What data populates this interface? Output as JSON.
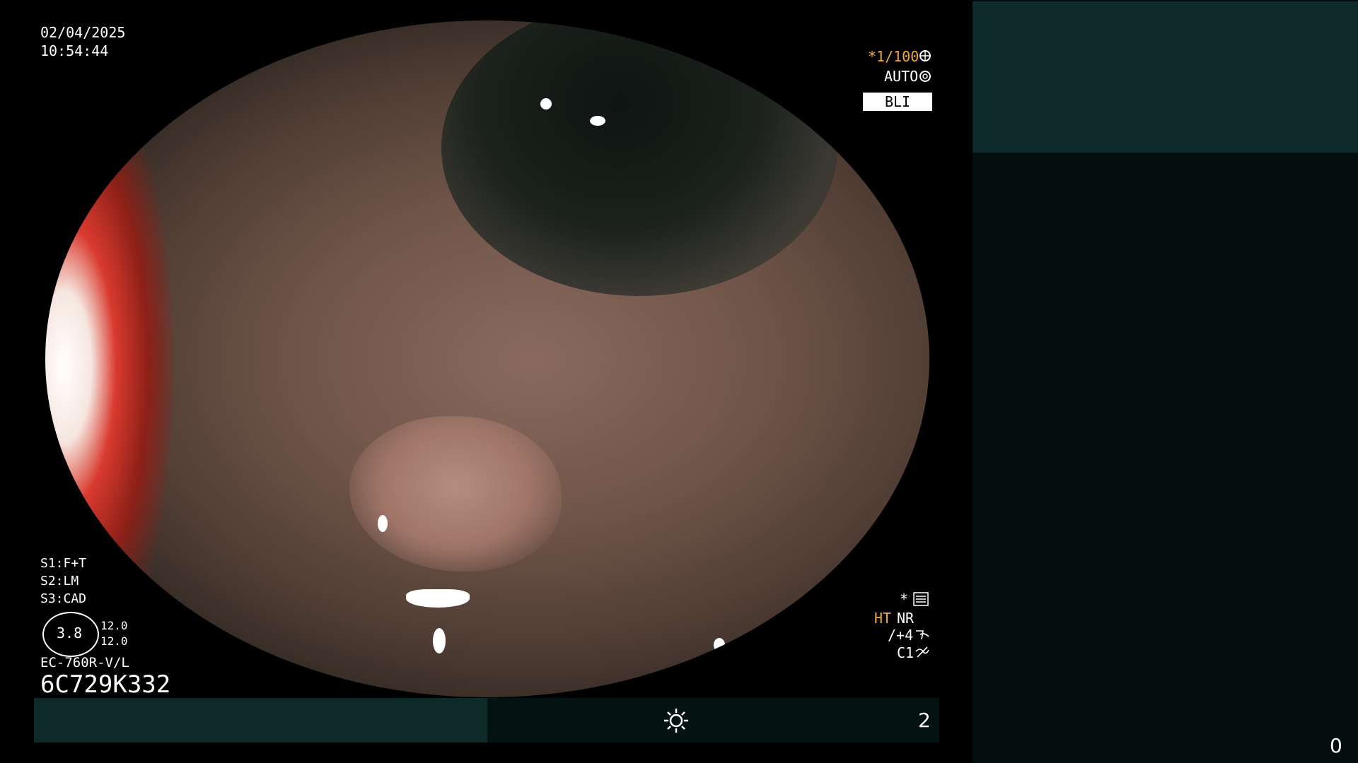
{
  "overlay": {
    "date": "02/04/2025",
    "time": "10:54:44",
    "shutter": "*1/100",
    "iris_mode": "AUTO",
    "mode_badge": "BLI",
    "s1": "S1:F+T",
    "s2": "S2:LM",
    "s3": "S3:CAD",
    "magnification": "3.8",
    "mag_val_1": "12.0",
    "mag_val_2": "12.0",
    "scope_model": "EC-760R-V/L",
    "scope_serial": "6C729K332",
    "enhance_star": "*",
    "ht_label": "HT",
    "nr_label": "NR",
    "structure": "/+4",
    "color": "C1",
    "counter_bottom": "2",
    "counter_right": "0"
  },
  "colors": {
    "accent_amber": "#f0a93a",
    "panel_teal": "#0e2a2b",
    "badge_bg": "#ffffff"
  },
  "icons": [
    "shutter-icon",
    "iris-icon",
    "menu-icon",
    "structure-icon",
    "color-icon",
    "brightness-icon"
  ]
}
